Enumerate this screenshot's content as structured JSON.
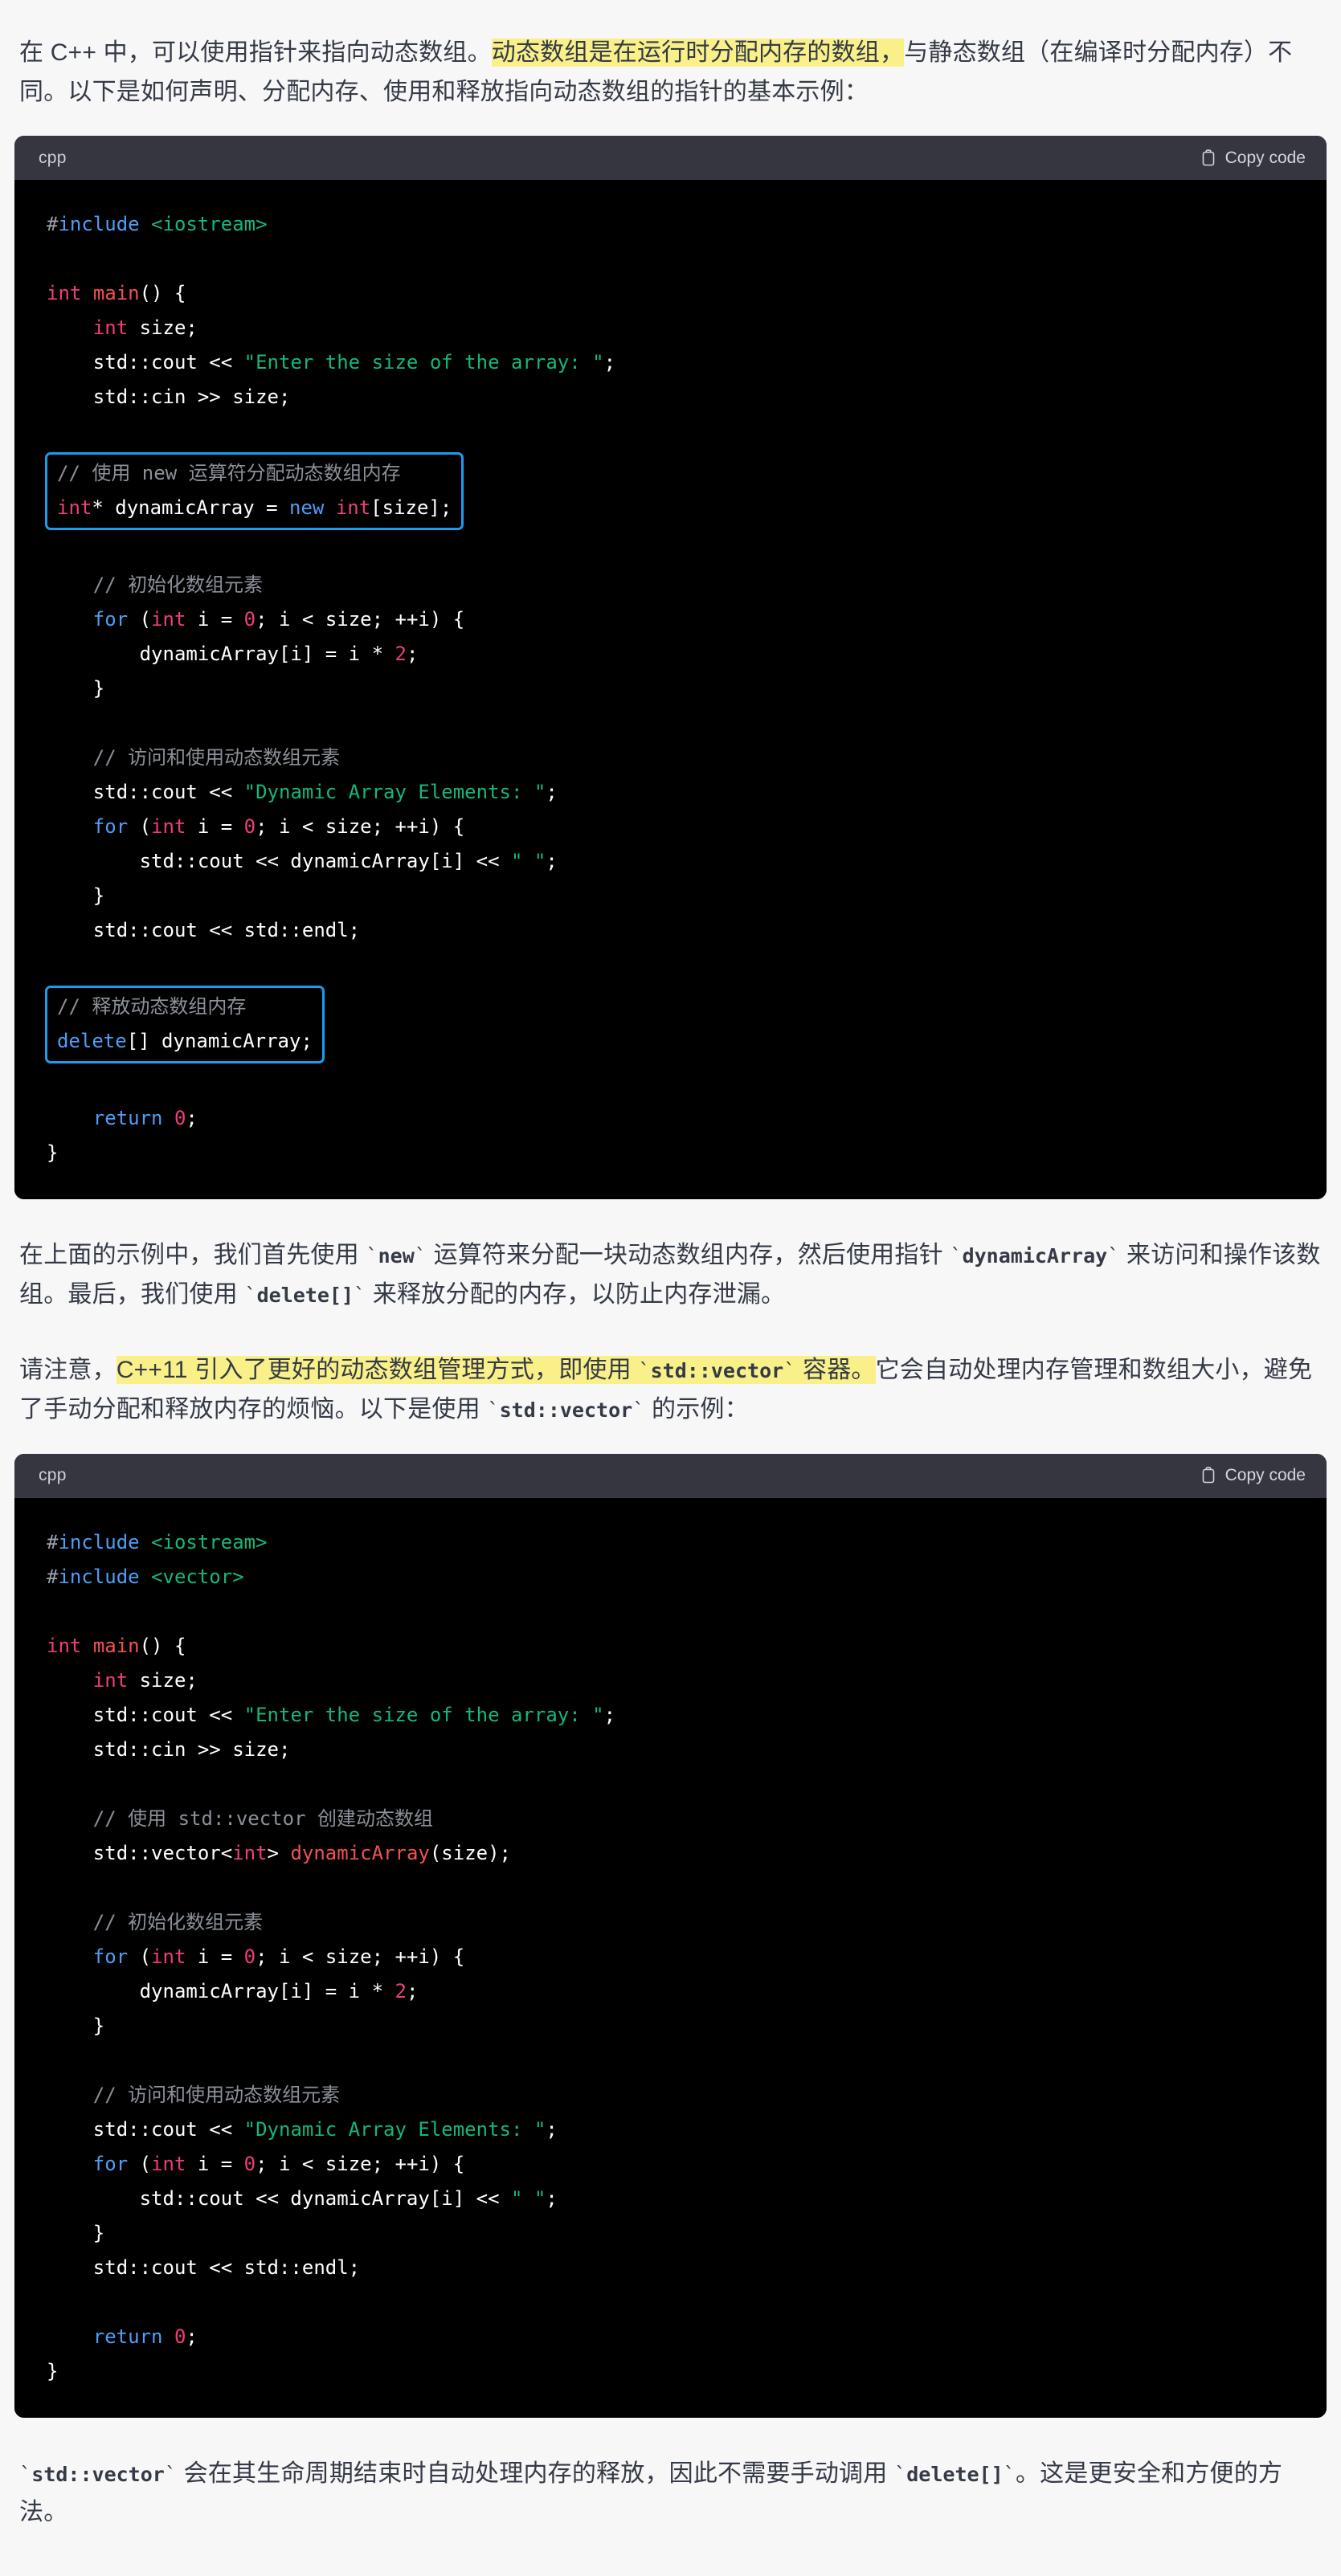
{
  "page": {
    "background": "#f7f7f8",
    "text_color": "#343a46",
    "highlight_color": "#faf08a",
    "annotation_box_color": "#1a9df0"
  },
  "intro": {
    "p1_a": "在 C++ 中，可以使用指针来指向动态数组。",
    "p1_highlight": "动态数组是在运行时分配内存的数组，",
    "p1_b": "与静态数组（在编译时分配内存）不同。以下是如何声明、分配内存、使用和释放指向动态数组的指针的基本示例："
  },
  "code_block_1": {
    "lang": "cpp",
    "copy_label": "Copy code",
    "copy_icon": "clipboard-icon",
    "lines": [
      "#include <iostream>",
      "",
      "int main() {",
      "    int size;",
      "    std::cout << \"Enter the size of the array: \";",
      "    std::cin >> size;",
      "",
      "    // 使用 new 运算符分配动态数组内存",
      "    int* dynamicArray = new int[size];",
      "",
      "    // 初始化数组元素",
      "    for (int i = 0; i < size; ++i) {",
      "        dynamicArray[i] = i * 2;",
      "    }",
      "",
      "    // 访问和使用动态数组元素",
      "    std::cout << \"Dynamic Array Elements: \";",
      "    for (int i = 0; i < size; ++i) {",
      "        std::cout << dynamicArray[i] << \" \";",
      "    }",
      "    std::cout << std::endl;",
      "",
      "    // 释放动态数组内存",
      "    delete[] dynamicArray;",
      "",
      "    return 0;",
      "}"
    ],
    "annotations": [
      {
        "name": "allocate-memory-box",
        "lines": [
          "// 使用 new 运算符分配动态数组内存",
          "int* dynamicArray = new int[size];"
        ]
      },
      {
        "name": "free-memory-box",
        "lines": [
          "// 释放动态数组内存",
          "delete[] dynamicArray;"
        ]
      }
    ]
  },
  "para_after_code1": {
    "a": "在上面的示例中，我们首先使用 ",
    "code1": "new",
    "b": " 运算符来分配一块动态数组内存，然后使用指针 ",
    "code2": "dynamicArray",
    "c": " 来访问和操作该数组。最后，我们使用 ",
    "code3": "delete[]",
    "d": " 来释放分配的内存，以防止内存泄漏。"
  },
  "para_note": {
    "a": "请注意，",
    "highlight_a": "C++11 引入了更好的动态数组管理方式，即使用 ",
    "highlight_code": "std::vector",
    "highlight_b": " 容器。",
    "b": "它会自动处理内存管理和数组大小，避免了手动分配和释放内存的烦恼。以下是使用 ",
    "code2": "std::vector",
    "c": " 的示例："
  },
  "code_block_2": {
    "lang": "cpp",
    "copy_label": "Copy code",
    "copy_icon": "clipboard-icon",
    "lines": [
      "#include <iostream>",
      "#include <vector>",
      "",
      "int main() {",
      "    int size;",
      "    std::cout << \"Enter the size of the array: \";",
      "    std::cin >> size;",
      "",
      "    // 使用 std::vector 创建动态数组",
      "    std::vector<int> dynamicArray(size);",
      "",
      "    // 初始化数组元素",
      "    for (int i = 0; i < size; ++i) {",
      "        dynamicArray[i] = i * 2;",
      "    }",
      "",
      "    // 访问和使用动态数组元素",
      "    std::cout << \"Dynamic Array Elements: \";",
      "    for (int i = 0; i < size; ++i) {",
      "        std::cout << dynamicArray[i] << \" \";",
      "    }",
      "    std::cout << std::endl;",
      "",
      "    return 0;",
      "}"
    ]
  },
  "para_footer": {
    "code1": "std::vector",
    "a": " 会在其生命周期结束时自动处理内存的释放，因此不需要手动调用 ",
    "code2": "delete[]",
    "b": "。这是更安全和方便的方法。"
  }
}
